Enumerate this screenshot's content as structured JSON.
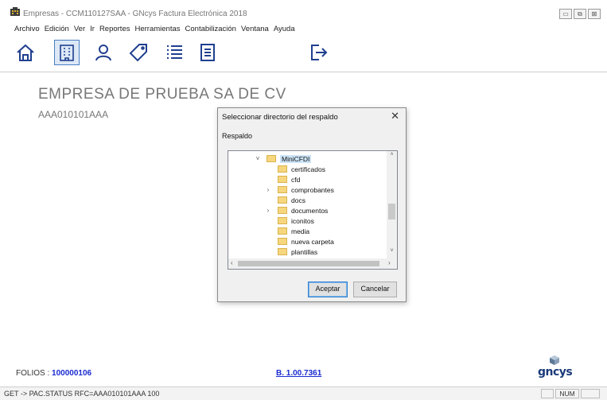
{
  "window": {
    "title": "Empresas - CCM110127SAA - GNcys Factura Electrónica 2018",
    "controls": [
      "minimize",
      "restore",
      "close"
    ]
  },
  "menu": [
    "Archivo",
    "Edición",
    "Ver",
    "Ir",
    "Reportes",
    "Herramientas",
    "Contabilización",
    "Ventana",
    "Ayuda"
  ],
  "toolbar": {
    "buttons": [
      "home-icon",
      "building-icon",
      "user-icon",
      "tag-icon",
      "list-icon",
      "document-icon",
      "exit-icon"
    ],
    "active": "building-icon"
  },
  "company": {
    "name": "EMPRESA DE PRUEBA SA DE CV",
    "rfc": "AAA010101AAA"
  },
  "dialog": {
    "title": "Seleccionar directorio del respaldo",
    "close_glyph": "✕",
    "prompt": "Respaldo",
    "tree": {
      "root": "MiniCFDI",
      "items": [
        "certificados",
        "cfd",
        "comprobantes",
        "docs",
        "documentos",
        "iconitos",
        "media",
        "nueva carpeta",
        "plantillas"
      ],
      "expandable": [
        "comprobantes",
        "documentos"
      ]
    },
    "accept_label": "Aceptar",
    "cancel_label": "Cancelar"
  },
  "footer": {
    "folios_label": "FOLIOS :",
    "folios_value": "100000106",
    "version": "B. 1.00.7361",
    "logo_text": "gncys"
  },
  "statusbar": {
    "text": "GET -> PAC.STATUS RFC=AAA010101AAA 100",
    "num": "NUM"
  },
  "colors": {
    "link_blue": "#1a2bd0",
    "toolbar_icon": "#1f3f8f",
    "selection": "#cce4f7",
    "folder": "#f6d77e"
  }
}
